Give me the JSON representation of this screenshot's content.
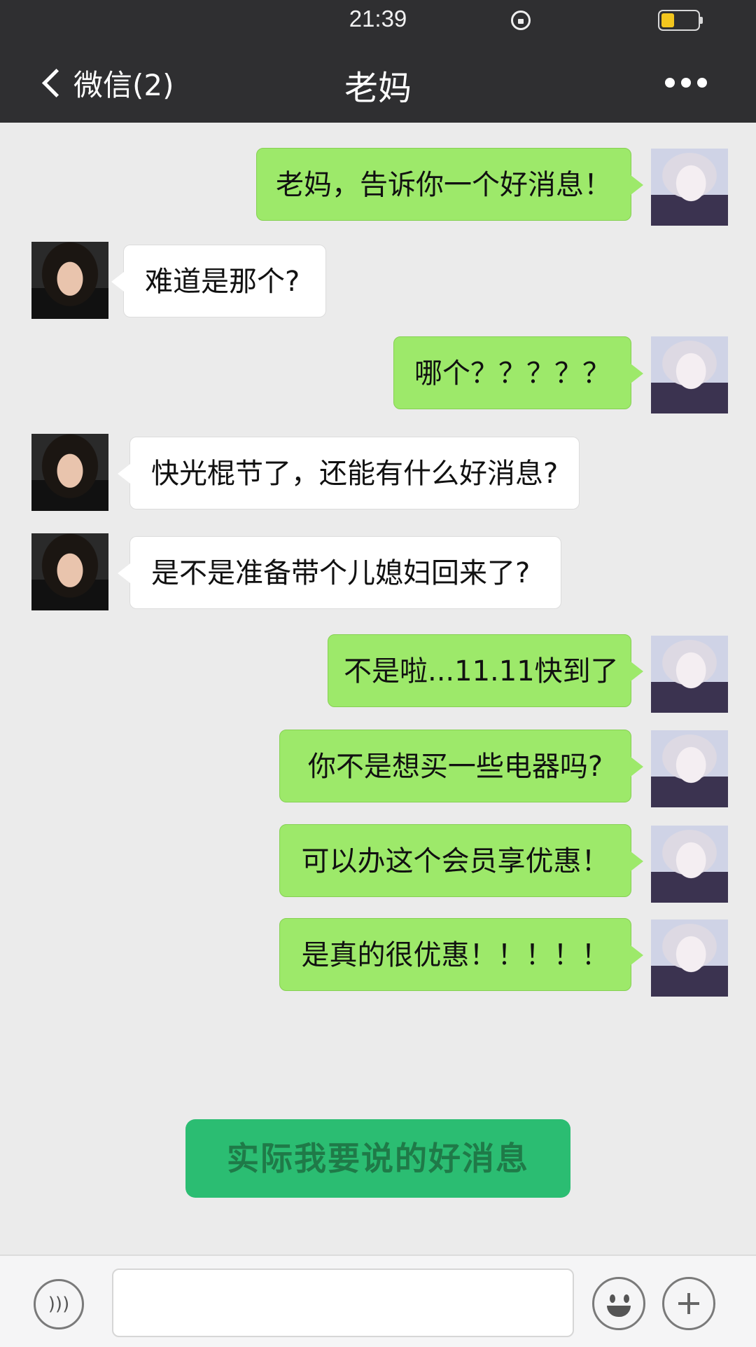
{
  "status_bar": {
    "time": "21:39"
  },
  "header": {
    "back_label": "微信(2)",
    "title": "老妈"
  },
  "messages": [
    {
      "side": "right",
      "text": "老妈，告诉你一个好消息！"
    },
    {
      "side": "left",
      "text": "难道是那个?"
    },
    {
      "side": "right",
      "text": "哪个？？？？？"
    },
    {
      "side": "left",
      "text": "快光棍节了，还能有什么好消息?"
    },
    {
      "side": "left",
      "text": "是不是准备带个儿媳妇回来了?"
    },
    {
      "side": "right",
      "text": "不是啦...11.11快到了"
    },
    {
      "side": "right",
      "text": "你不是想买一些电器吗?"
    },
    {
      "side": "right",
      "text": "可以办这个会员享优惠！"
    },
    {
      "side": "right",
      "text": "是真的很优惠！！！！！"
    }
  ],
  "banner": {
    "text": "实际我要说的好消息"
  },
  "input_bar": {
    "input_value": ""
  },
  "colors": {
    "nav_bg": "#2f2f31",
    "chat_bg": "#ebebeb",
    "sent_bubble": "#9de96a",
    "received_bubble": "#ffffff",
    "banner_bg": "#2bbd72"
  },
  "icons": [
    "back-chevron-icon",
    "lock-rotation-icon",
    "battery-icon",
    "more-icon",
    "voice-icon",
    "emoji-icon",
    "plus-icon"
  ]
}
